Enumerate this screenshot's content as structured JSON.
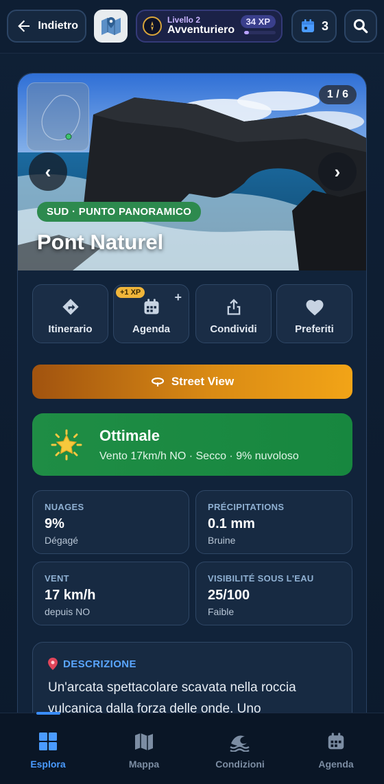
{
  "topbar": {
    "back_label": "Indietro",
    "level_label": "Livello 2",
    "level_name": "Avventuriero",
    "xp": "34 XP",
    "xp_progress": 0.15,
    "calendar_count": "3"
  },
  "hero": {
    "counter": "1 / 6",
    "tag": "SUD · PUNTO PANORAMICO",
    "title": "Pont Naturel"
  },
  "actions": [
    {
      "label": "Itinerario",
      "icon": "directions-icon"
    },
    {
      "label": "Agenda",
      "icon": "calendar-add-icon",
      "badge": "+1 XP"
    },
    {
      "label": "Condividi",
      "icon": "share-icon"
    },
    {
      "label": "Preferiti",
      "icon": "heart-icon"
    }
  ],
  "street_view": {
    "label": "Street View"
  },
  "weather": {
    "status": "Ottimale",
    "summary": "Vento 17km/h NO · Secco · 9% nuvoloso"
  },
  "stats": [
    {
      "label": "NUAGES",
      "value": "9%",
      "sub": "Dégagé"
    },
    {
      "label": "PRÉCIPITATIONS",
      "value": "0.1 mm",
      "sub": "Bruine"
    },
    {
      "label": "VENT",
      "value": "17 km/h",
      "sub": "depuis NO"
    },
    {
      "label": "VISIBILITÉ SOUS L'EAU",
      "value": "25/100",
      "sub": "Faible"
    }
  ],
  "description": {
    "heading": "DESCRIZIONE",
    "text": "Un'arcata spettacolare scavata nella roccia vulcanica dalla forza delle onde. Uno"
  },
  "bottom_nav": [
    {
      "label": "Esplora",
      "active": true
    },
    {
      "label": "Mappa",
      "active": false
    },
    {
      "label": "Condizioni",
      "active": false
    },
    {
      "label": "Agenda",
      "active": false
    }
  ],
  "colors": {
    "accent": "#3a8dff",
    "green": "#1f8d45",
    "orange": "#f2a417",
    "background": "#0c1a2c"
  }
}
